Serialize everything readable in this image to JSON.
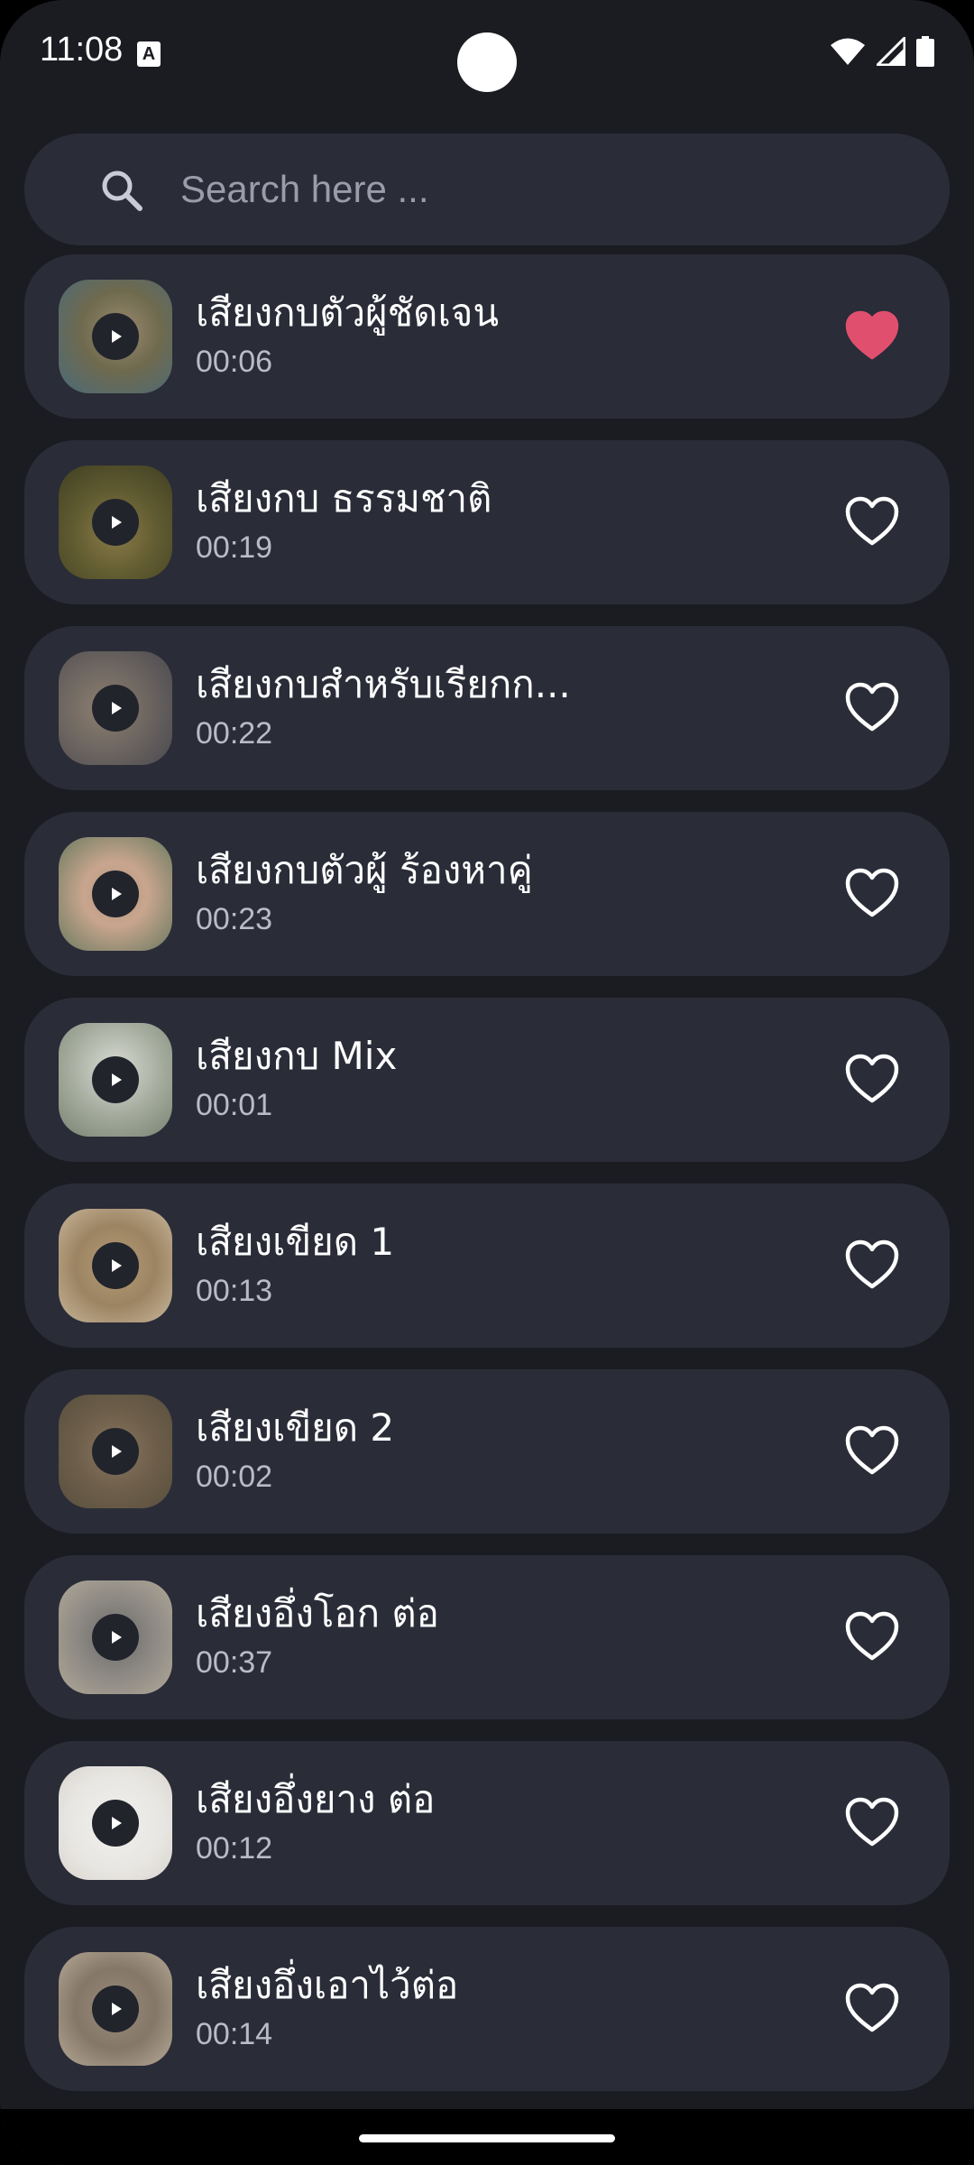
{
  "status_bar": {
    "time": "11:08",
    "notification_icon": "A"
  },
  "search": {
    "placeholder": "Search here ..."
  },
  "colors": {
    "background": "#1b1c22",
    "card": "#2a2c38",
    "favorite_active": "#e0506e",
    "favorite_inactive": "#ffffff"
  },
  "sounds": [
    {
      "title": "เสียงกบตัวผู้ชัดเจน",
      "duration": "00:06",
      "favorite": true,
      "thumb": "thumb-1"
    },
    {
      "title": "เสียงกบ ธรรมชาติ",
      "duration": "00:19",
      "favorite": false,
      "thumb": "thumb-2"
    },
    {
      "title": "เสียงกบสำหรับเรียกก...",
      "duration": "00:22",
      "favorite": false,
      "thumb": "thumb-3"
    },
    {
      "title": "เสียงกบตัวผู้ ร้องหาคู่",
      "duration": "00:23",
      "favorite": false,
      "thumb": "thumb-4"
    },
    {
      "title": "เสียงกบ Mix",
      "duration": "00:01",
      "favorite": false,
      "thumb": "thumb-5"
    },
    {
      "title": "เสียงเขียด 1",
      "duration": "00:13",
      "favorite": false,
      "thumb": "thumb-6"
    },
    {
      "title": "เสียงเขียด 2",
      "duration": "00:02",
      "favorite": false,
      "thumb": "thumb-7"
    },
    {
      "title": "เสียงอึ่งโอก ต่อ",
      "duration": "00:37",
      "favorite": false,
      "thumb": "thumb-8"
    },
    {
      "title": "เสียงอึ่งยาง ต่อ",
      "duration": "00:12",
      "favorite": false,
      "thumb": "thumb-9"
    },
    {
      "title": "เสียงอึ่งเอาไว้ต่อ",
      "duration": "00:14",
      "favorite": false,
      "thumb": "thumb-10"
    }
  ]
}
